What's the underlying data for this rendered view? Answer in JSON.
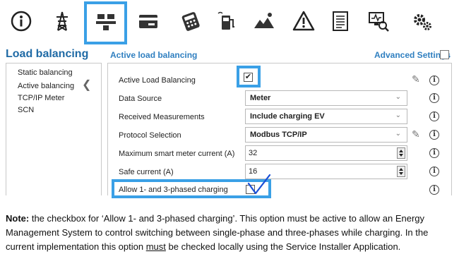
{
  "toolbar": {
    "icons": [
      "info-icon",
      "power-tower-icon",
      "load-balancing-icon",
      "card-icon",
      "payment-terminal-icon",
      "charging-station-icon",
      "image-icon",
      "warning-icon",
      "document-icon",
      "diagnostics-icon",
      "settings-icon"
    ],
    "selected": "load-balancing-icon",
    "accent": "#3aa0e6"
  },
  "page": {
    "title": "Load balancing"
  },
  "section": {
    "title": "Active load balancing",
    "advanced_label": "Advanced Settings"
  },
  "nav": {
    "items": [
      {
        "label": "Static balancing"
      },
      {
        "label": "Active balancing",
        "selected": true
      },
      {
        "label": "TCP/IP Meter"
      },
      {
        "label": "SCN"
      }
    ],
    "arrow": "❮"
  },
  "form": {
    "rows": [
      {
        "label": "Active Load Balancing",
        "type": "checkbox",
        "checked": true,
        "check_glyph": "✔"
      },
      {
        "label": "Data Source",
        "type": "select",
        "value": "Meter"
      },
      {
        "label": "Received Measurements",
        "type": "select",
        "value": "Include charging EV"
      },
      {
        "label": "Protocol Selection",
        "type": "select",
        "value": "Modbus TCP/IP"
      },
      {
        "label": "Maximum smart meter current (A)",
        "type": "number",
        "value": "32"
      },
      {
        "label": "Safe current (A)",
        "type": "number",
        "value": "16"
      },
      {
        "label": "Allow 1- and 3-phased charging",
        "type": "checkbox",
        "checked": false
      }
    ],
    "info_glyph": "i",
    "pencil_glyph": "✎",
    "select_arrow": "⌄"
  },
  "note": {
    "bold": "Note:",
    "part1": " the checkbox for  ‘Allow 1- and 3-phased charging’. This option must be active to allow an Energy Management System to control switching between single-phase and three-phases while charging. In the current implementation this option ",
    "underlined": "must",
    "part2": " be checked locally using the Service Installer Application."
  }
}
